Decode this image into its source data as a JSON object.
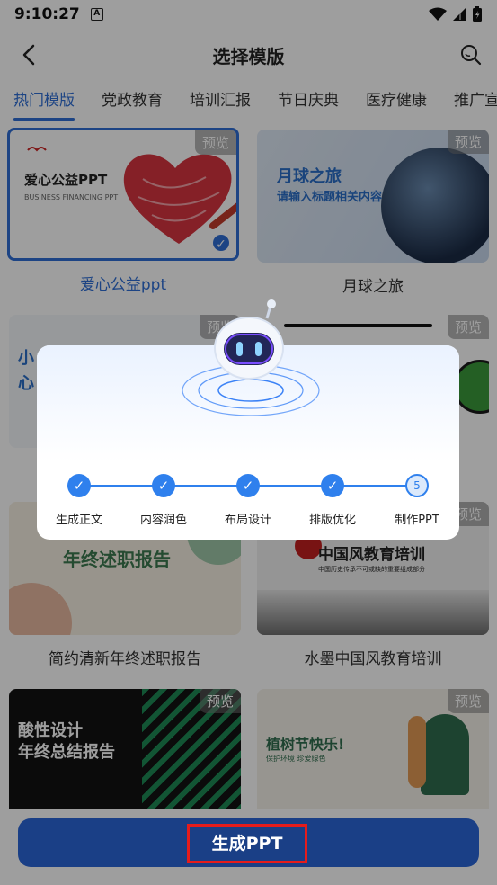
{
  "status": {
    "time": "9:10:27",
    "notif_letter": "A"
  },
  "header": {
    "title": "选择模版"
  },
  "tabs": [
    {
      "label": "热门模版",
      "active": true
    },
    {
      "label": "党政教育"
    },
    {
      "label": "培训汇报"
    },
    {
      "label": "节日庆典"
    },
    {
      "label": "医疗健康"
    },
    {
      "label": "推广宣"
    }
  ],
  "cards": [
    {
      "label": "爱心公益ppt",
      "preview": "预览",
      "selected": true,
      "thumb_title": "爱心公益PPT",
      "thumb_sub": "BUSINESS FINANCING PPT"
    },
    {
      "label": "月球之旅",
      "preview": "预览",
      "thumb_title": "月球之旅",
      "thumb_sub": "请输入标题相关内容"
    },
    {
      "label": "",
      "preview": "预览",
      "thumb_title": "小",
      "thumb_sub": "心"
    },
    {
      "label": "",
      "preview": "预览"
    },
    {
      "label": "简约清新年终述职报告",
      "preview": "预览",
      "thumb_title": "年终述职报告"
    },
    {
      "label": "水墨中国风教育培训",
      "preview": "预览",
      "thumb_title": "中国风教育培训",
      "thumb_sub": "中国历史传承不可或缺的重要组成部分"
    },
    {
      "label": "",
      "preview": "预览",
      "thumb_title": "酸性设计",
      "thumb_sub": "年终总结报告"
    },
    {
      "label": "",
      "preview": "预览",
      "thumb_title": "植树节快乐!",
      "thumb_sub": "保护环境 珍爱绿色"
    }
  ],
  "progress": {
    "steps": [
      {
        "label": "生成正文",
        "done": true
      },
      {
        "label": "内容润色",
        "done": true
      },
      {
        "label": "布局设计",
        "done": true
      },
      {
        "label": "排版优化",
        "done": true
      },
      {
        "label": "制作PPT",
        "done": false,
        "number": "5"
      }
    ]
  },
  "bottom": {
    "generate_label": "生成PPT"
  },
  "colors": {
    "accent": "#2f6fd6",
    "button": "#2a66d9",
    "highlight_box": "#e51c1c"
  }
}
